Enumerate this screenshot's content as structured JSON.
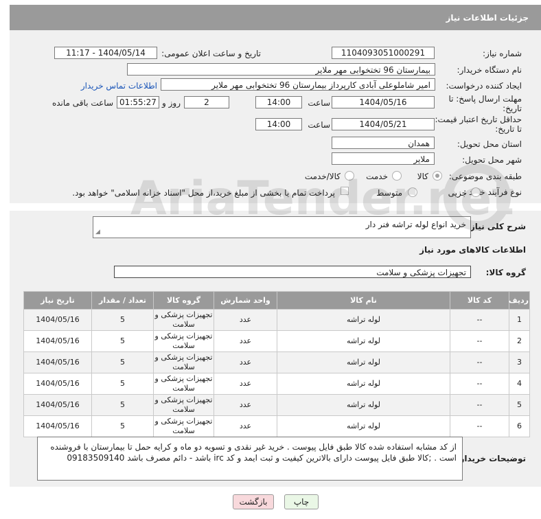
{
  "header": {
    "title": "جزئیات اطلاعات نیاز"
  },
  "form": {
    "need_number": {
      "label": "شماره نیاز:",
      "value": "1104093051000291"
    },
    "announce_datetime": {
      "label": "تاریخ و ساعت اعلان عمومی:",
      "value": "1404/05/14 - 11:17"
    },
    "buyer_org": {
      "label": "نام دستگاه خریدار:",
      "value": "بیمارستان 96 تختخوابی مهر ملایر"
    },
    "requester": {
      "label": "ایجاد کننده درخواست:",
      "value": "امیر شاملوعلی آبادی کارپرداز بیمارستان 96 تختخوابی مهر ملایر",
      "contact_link": "اطلاعات تماس خریدار"
    },
    "reply_deadline": {
      "label": "مهلت ارسال پاسخ: تا تاریخ:",
      "date": "1404/05/16",
      "time_label": "ساعت",
      "time": "14:00",
      "days": "2",
      "days_label": "روز و",
      "remaining": "01:55:27",
      "remaining_label": "ساعت باقی مانده"
    },
    "price_validity": {
      "label": "حداقل تاریخ اعتبار قیمت: تا تاریخ:",
      "date": "1404/05/21",
      "time_label": "ساعت",
      "time": "14:00"
    },
    "delivery_province": {
      "label": "استان محل تحویل:",
      "value": "همدان"
    },
    "delivery_city": {
      "label": "شهر محل تحویل:",
      "value": "ملایر"
    },
    "category": {
      "label": "طبقه بندی موضوعی:",
      "options": [
        "کالا",
        "خدمت",
        "کالا/خدمت"
      ],
      "selected": "کالا"
    },
    "process_type": {
      "label": "نوع فرآیند خرید :",
      "options": [
        "جزیی",
        "متوسط"
      ],
      "payment_note": "پرداخت تمام یا بخشی از مبلغ خرید،از محل \"اسناد خزانه اسلامی\" خواهد بود."
    }
  },
  "general_desc": {
    "label": "شرح کلی نیاز:",
    "value": "خرید انواع لوله تراشه فنر دار"
  },
  "goods_section": {
    "title": "اطلاعات کالاهای مورد نیاز",
    "group_label": "گروه کالا:",
    "group_value": "تجهیزات پزشکی و سلامت"
  },
  "table": {
    "headers": [
      "ردیف",
      "کد کالا",
      "نام کالا",
      "واحد شمارش",
      "گروه کالا",
      "تعداد / مقدار",
      "تاریخ نیاز"
    ],
    "rows": [
      [
        "1",
        "--",
        "لوله تراشه",
        "عدد",
        "تجهیزات پزشکی و سلامت",
        "5",
        "1404/05/16"
      ],
      [
        "2",
        "--",
        "لوله تراشه",
        "عدد",
        "تجهیزات پزشکی و سلامت",
        "5",
        "1404/05/16"
      ],
      [
        "3",
        "--",
        "لوله تراشه",
        "عدد",
        "تجهیزات پزشکی و سلامت",
        "5",
        "1404/05/16"
      ],
      [
        "4",
        "--",
        "لوله تراشه",
        "عدد",
        "تجهیزات پزشکی و سلامت",
        "5",
        "1404/05/16"
      ],
      [
        "5",
        "--",
        "لوله تراشه",
        "عدد",
        "تجهیزات پزشکی و سلامت",
        "5",
        "1404/05/16"
      ],
      [
        "6",
        "--",
        "لوله تراشه",
        "عدد",
        "تجهیزات پزشکی و سلامت",
        "5",
        "1404/05/16"
      ]
    ]
  },
  "buyer_notes": {
    "label": "توضیحات خریدار:",
    "line1": "از کد مشابه استفاده شده کالا طبق فایل پیوست . خرید غیر نقدی و تسویه دو ماه و کرایه حمل تا بیمارستان با فروشنده",
    "line2": "است .  ;کالا طبق فایل پیوست   دارای بالاترین کیفیت و ثبت ایمد  و کد  irc  باشد - دائم مصرف  باشد   09183509140"
  },
  "buttons": {
    "print": "چاپ",
    "back": "بازگشت"
  },
  "watermark": {
    "text": "AriaTender.net"
  },
  "colors": {
    "header_bg": "#9a9a9a",
    "link": "#1a55b8",
    "back_btn_bg": "#f8d9dc",
    "print_btn_bg": "#eaf7e6"
  }
}
